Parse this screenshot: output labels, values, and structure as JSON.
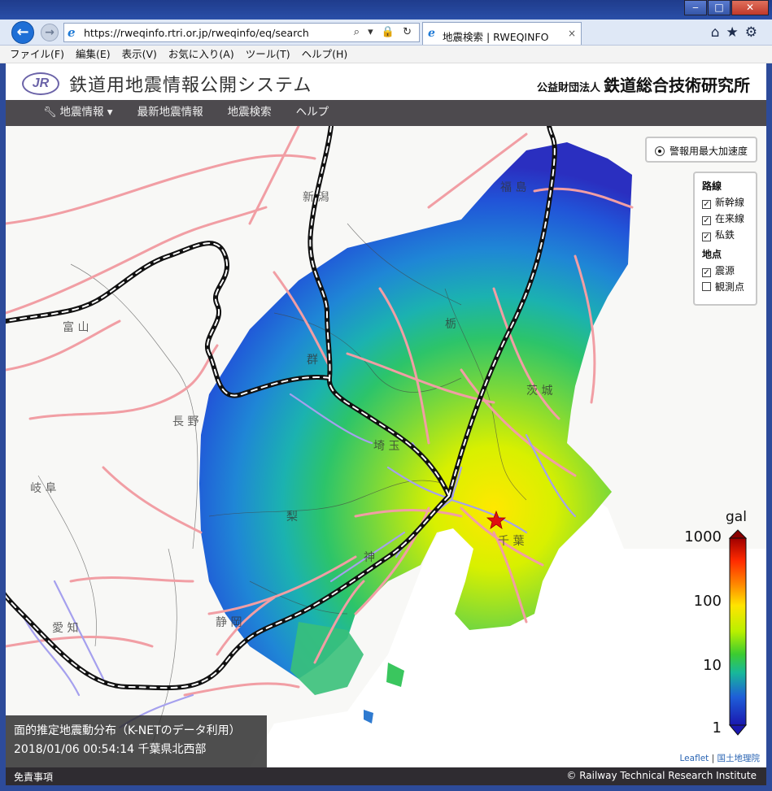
{
  "window": {
    "minimize_glyph": "‒",
    "maximize_glyph": "□",
    "close_glyph": "✕"
  },
  "browser": {
    "url": "https://rweqinfo.rtri.or.jp/rweqinfo/eq/search",
    "address_tools": "⌕ ▾ 🔒 ↻",
    "tab_title": "地震検索 | RWEQINFO",
    "tab_close": "×",
    "back_glyph": "←",
    "forward_glyph": "→",
    "right_icons": "⌂★⚙"
  },
  "menu": [
    "ファイル(F)",
    "編集(E)",
    "表示(V)",
    "お気に入り(A)",
    "ツール(T)",
    "ヘルプ(H)"
  ],
  "header": {
    "logo_text": "JR",
    "site_title": "鉄道用地震情報公開システム",
    "org_prefix": "公益財団法人",
    "org_name": "鉄道総合技術研究所"
  },
  "site_nav": [
    "地震情報 ▾",
    "最新地震情報",
    "地震検索",
    "ヘルプ"
  ],
  "map": {
    "radio_label": "警報用最大加速度",
    "layers": {
      "lines_heading": "路線",
      "lines": [
        {
          "label": "新幹線",
          "checked": true
        },
        {
          "label": "在来線",
          "checked": true
        },
        {
          "label": "私鉄",
          "checked": true
        }
      ],
      "points_heading": "地点",
      "points": [
        {
          "label": "震源",
          "checked": true
        },
        {
          "label": "観測点",
          "checked": false
        }
      ]
    },
    "prefecture_labels": [
      "新 潟",
      "福 島",
      "富 山",
      "群",
      "栃",
      "茨 城",
      "長 野",
      "埼 玉",
      "岐 阜",
      "千 葉",
      "神",
      "静 岡",
      "愛 知",
      "梨"
    ],
    "legend": {
      "unit": "gal",
      "ticks": [
        "1000",
        "100",
        "10",
        "1"
      ],
      "colors": [
        "#b00000",
        "#ff3000",
        "#ff9a00",
        "#ffe800",
        "#b4f000",
        "#3ccc30",
        "#19b99a",
        "#1e60d8",
        "#1a18b0"
      ]
    },
    "info": {
      "line1": "面的推定地震動分布（K-NETのデータ利用）",
      "line2": "2018/01/06 00:54:14 千葉県北西部"
    },
    "attribution_leaflet": "Leaflet",
    "attribution_sep": " | ",
    "attribution_gsi": "国土地理院"
  },
  "footer": {
    "disclaimer": "免責事項",
    "copyright": "© Railway Technical Research Institute"
  }
}
